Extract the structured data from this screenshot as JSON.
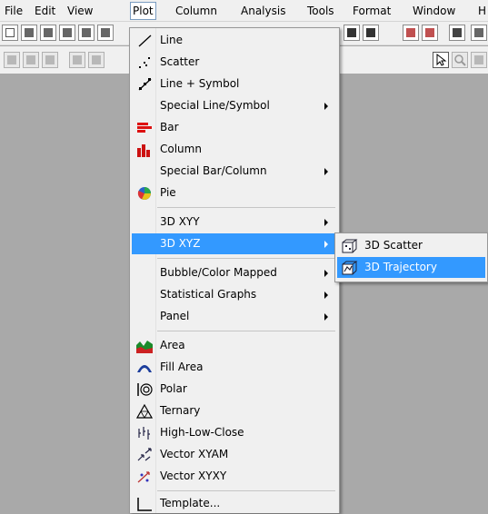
{
  "menubar": {
    "items": [
      "File",
      "Edit",
      "View",
      "Plot",
      "Column",
      "Analysis",
      "Tools",
      "Format",
      "Window",
      "H"
    ],
    "active": "Plot"
  },
  "plot_menu": {
    "items": [
      {
        "label": "Line",
        "icon": "line-icon"
      },
      {
        "label": "Scatter",
        "icon": "scatter-icon"
      },
      {
        "label": "Line + Symbol",
        "icon": "line-symbol-icon"
      },
      {
        "label": "Special Line/Symbol",
        "submenu": true
      },
      {
        "label": "Bar",
        "icon": "bar-chart-icon"
      },
      {
        "label": "Column",
        "icon": "column-chart-icon"
      },
      {
        "label": "Special Bar/Column",
        "submenu": true
      },
      {
        "label": "Pie",
        "icon": "pie-chart-icon"
      },
      {
        "label": "3D XYY",
        "submenu": true
      },
      {
        "label": "3D XYZ",
        "submenu": true,
        "highlighted": true
      },
      {
        "label": "Bubble/Color Mapped",
        "submenu": true
      },
      {
        "label": "Statistical Graphs",
        "submenu": true
      },
      {
        "label": "Panel",
        "submenu": true
      },
      {
        "label": "Area",
        "icon": "area-chart-icon"
      },
      {
        "label": "Fill Area",
        "icon": "fill-area-icon"
      },
      {
        "label": "Polar",
        "icon": "polar-icon"
      },
      {
        "label": "Ternary",
        "icon": "ternary-icon"
      },
      {
        "label": "High-Low-Close",
        "icon": "high-low-close-icon"
      },
      {
        "label": "Vector XYAM",
        "icon": "vector-xyam-icon"
      },
      {
        "label": "Vector XYXY",
        "icon": "vector-xyxy-icon"
      },
      {
        "label": "Template...",
        "icon": "template-icon"
      }
    ]
  },
  "submenu_3d_xyz": {
    "items": [
      {
        "label": "3D Scatter",
        "icon": "3d-scatter-icon"
      },
      {
        "label": "3D Trajectory",
        "icon": "3d-trajectory-icon",
        "highlighted": true
      }
    ]
  },
  "colors": {
    "highlight": "#3399ff",
    "workspace": "#a9a9a9",
    "menu_bg": "#f0f0f0"
  }
}
